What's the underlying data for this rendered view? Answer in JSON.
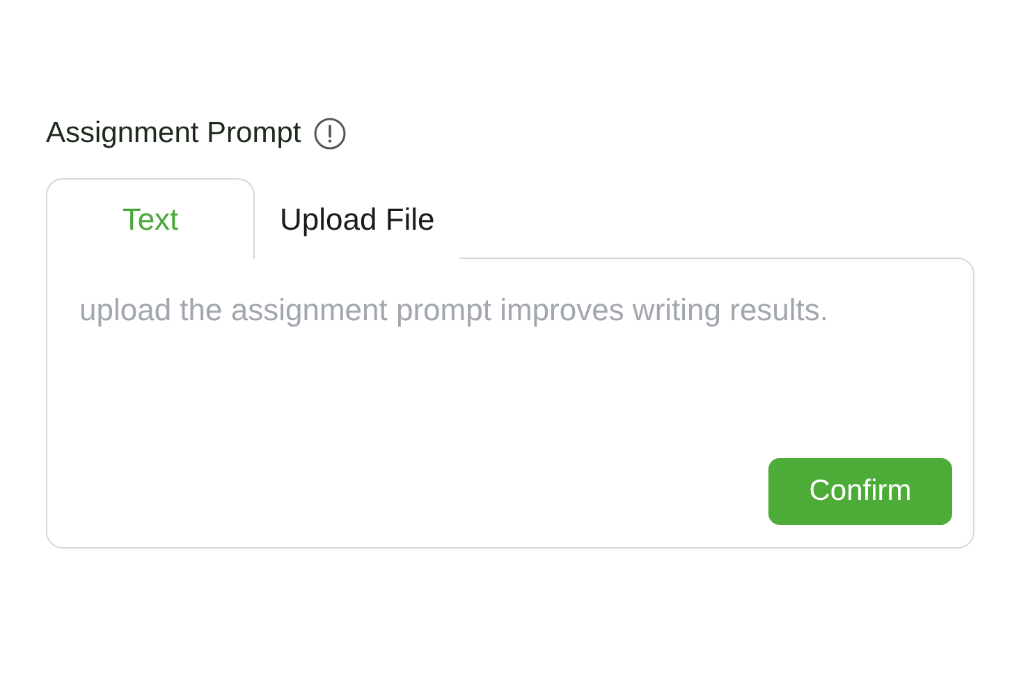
{
  "label": "Assignment Prompt",
  "tabs": [
    {
      "label": "Text",
      "selected": true
    },
    {
      "label": "Upload File",
      "selected": false
    }
  ],
  "prompt_field": {
    "placeholder": "upload the assignment prompt improves writing results."
  },
  "confirm_button": "Confirm"
}
